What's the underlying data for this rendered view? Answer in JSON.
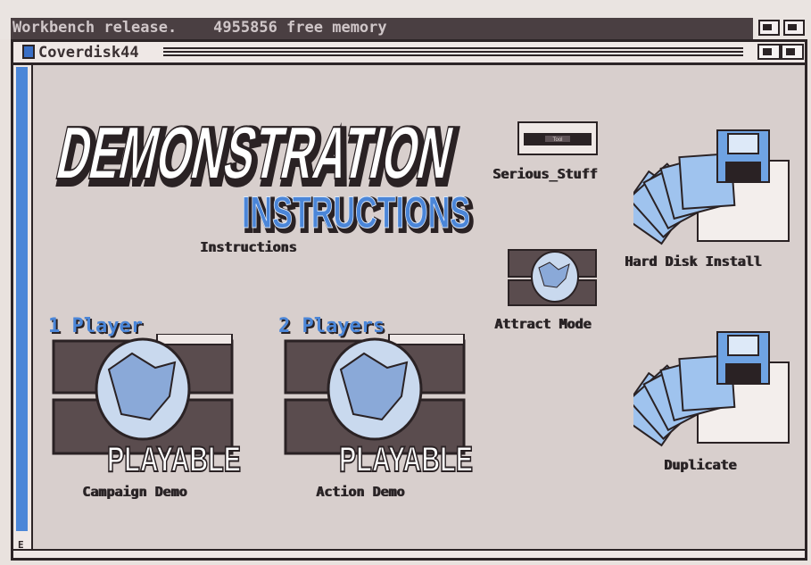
{
  "screen": {
    "title": "Workbench release.    4955856 free memory"
  },
  "window": {
    "title": "Coverdisk44",
    "left_gadget_letter": "E"
  },
  "logo": {
    "line1": "DEMONSTRATION",
    "line2": "INSTRUCTIONS"
  },
  "icons": {
    "instructions": {
      "label": "Instructions"
    },
    "serious_stuff": {
      "label": "Serious_Stuff",
      "plate_text": "Tool"
    },
    "hard_disk_install": {
      "label": "Hard Disk Install"
    },
    "attract_mode": {
      "label": "Attract Mode"
    },
    "campaign_demo": {
      "label": "Campaign Demo",
      "player_tag": "1 Player",
      "badge": "PLAYABLE"
    },
    "action_demo": {
      "label": "Action Demo",
      "player_tag": "2 Players",
      "badge": "PLAYABLE"
    },
    "duplicate": {
      "label": "Duplicate"
    }
  },
  "colors": {
    "workbench_bg": "#d8cfcd",
    "accent_blue": "#4b86d8",
    "dark": "#2c2426"
  }
}
